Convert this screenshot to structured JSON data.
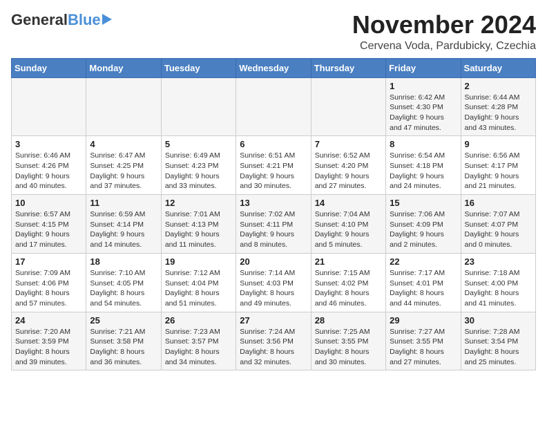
{
  "header": {
    "logo_general": "General",
    "logo_blue": "Blue",
    "month_title": "November 2024",
    "location": "Cervena Voda, Pardubicky, Czechia"
  },
  "days_of_week": [
    "Sunday",
    "Monday",
    "Tuesday",
    "Wednesday",
    "Thursday",
    "Friday",
    "Saturday"
  ],
  "weeks": [
    [
      {
        "day": "",
        "info": ""
      },
      {
        "day": "",
        "info": ""
      },
      {
        "day": "",
        "info": ""
      },
      {
        "day": "",
        "info": ""
      },
      {
        "day": "",
        "info": ""
      },
      {
        "day": "1",
        "info": "Sunrise: 6:42 AM\nSunset: 4:30 PM\nDaylight: 9 hours and 47 minutes."
      },
      {
        "day": "2",
        "info": "Sunrise: 6:44 AM\nSunset: 4:28 PM\nDaylight: 9 hours and 43 minutes."
      }
    ],
    [
      {
        "day": "3",
        "info": "Sunrise: 6:46 AM\nSunset: 4:26 PM\nDaylight: 9 hours and 40 minutes."
      },
      {
        "day": "4",
        "info": "Sunrise: 6:47 AM\nSunset: 4:25 PM\nDaylight: 9 hours and 37 minutes."
      },
      {
        "day": "5",
        "info": "Sunrise: 6:49 AM\nSunset: 4:23 PM\nDaylight: 9 hours and 33 minutes."
      },
      {
        "day": "6",
        "info": "Sunrise: 6:51 AM\nSunset: 4:21 PM\nDaylight: 9 hours and 30 minutes."
      },
      {
        "day": "7",
        "info": "Sunrise: 6:52 AM\nSunset: 4:20 PM\nDaylight: 9 hours and 27 minutes."
      },
      {
        "day": "8",
        "info": "Sunrise: 6:54 AM\nSunset: 4:18 PM\nDaylight: 9 hours and 24 minutes."
      },
      {
        "day": "9",
        "info": "Sunrise: 6:56 AM\nSunset: 4:17 PM\nDaylight: 9 hours and 21 minutes."
      }
    ],
    [
      {
        "day": "10",
        "info": "Sunrise: 6:57 AM\nSunset: 4:15 PM\nDaylight: 9 hours and 17 minutes."
      },
      {
        "day": "11",
        "info": "Sunrise: 6:59 AM\nSunset: 4:14 PM\nDaylight: 9 hours and 14 minutes."
      },
      {
        "day": "12",
        "info": "Sunrise: 7:01 AM\nSunset: 4:13 PM\nDaylight: 9 hours and 11 minutes."
      },
      {
        "day": "13",
        "info": "Sunrise: 7:02 AM\nSunset: 4:11 PM\nDaylight: 9 hours and 8 minutes."
      },
      {
        "day": "14",
        "info": "Sunrise: 7:04 AM\nSunset: 4:10 PM\nDaylight: 9 hours and 5 minutes."
      },
      {
        "day": "15",
        "info": "Sunrise: 7:06 AM\nSunset: 4:09 PM\nDaylight: 9 hours and 2 minutes."
      },
      {
        "day": "16",
        "info": "Sunrise: 7:07 AM\nSunset: 4:07 PM\nDaylight: 9 hours and 0 minutes."
      }
    ],
    [
      {
        "day": "17",
        "info": "Sunrise: 7:09 AM\nSunset: 4:06 PM\nDaylight: 8 hours and 57 minutes."
      },
      {
        "day": "18",
        "info": "Sunrise: 7:10 AM\nSunset: 4:05 PM\nDaylight: 8 hours and 54 minutes."
      },
      {
        "day": "19",
        "info": "Sunrise: 7:12 AM\nSunset: 4:04 PM\nDaylight: 8 hours and 51 minutes."
      },
      {
        "day": "20",
        "info": "Sunrise: 7:14 AM\nSunset: 4:03 PM\nDaylight: 8 hours and 49 minutes."
      },
      {
        "day": "21",
        "info": "Sunrise: 7:15 AM\nSunset: 4:02 PM\nDaylight: 8 hours and 46 minutes."
      },
      {
        "day": "22",
        "info": "Sunrise: 7:17 AM\nSunset: 4:01 PM\nDaylight: 8 hours and 44 minutes."
      },
      {
        "day": "23",
        "info": "Sunrise: 7:18 AM\nSunset: 4:00 PM\nDaylight: 8 hours and 41 minutes."
      }
    ],
    [
      {
        "day": "24",
        "info": "Sunrise: 7:20 AM\nSunset: 3:59 PM\nDaylight: 8 hours and 39 minutes."
      },
      {
        "day": "25",
        "info": "Sunrise: 7:21 AM\nSunset: 3:58 PM\nDaylight: 8 hours and 36 minutes."
      },
      {
        "day": "26",
        "info": "Sunrise: 7:23 AM\nSunset: 3:57 PM\nDaylight: 8 hours and 34 minutes."
      },
      {
        "day": "27",
        "info": "Sunrise: 7:24 AM\nSunset: 3:56 PM\nDaylight: 8 hours and 32 minutes."
      },
      {
        "day": "28",
        "info": "Sunrise: 7:25 AM\nSunset: 3:55 PM\nDaylight: 8 hours and 30 minutes."
      },
      {
        "day": "29",
        "info": "Sunrise: 7:27 AM\nSunset: 3:55 PM\nDaylight: 8 hours and 27 minutes."
      },
      {
        "day": "30",
        "info": "Sunrise: 7:28 AM\nSunset: 3:54 PM\nDaylight: 8 hours and 25 minutes."
      }
    ]
  ]
}
